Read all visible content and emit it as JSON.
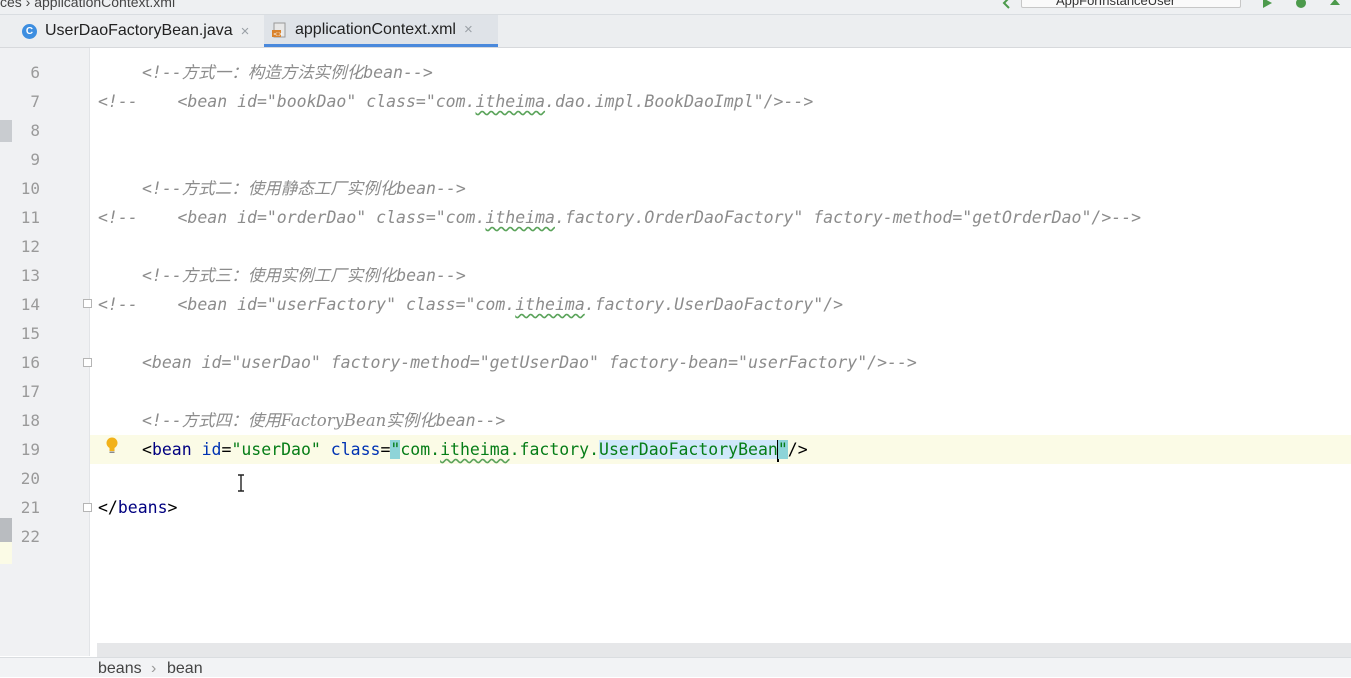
{
  "window": {
    "breadcrumb_top": "ces › applicationContext.xml",
    "run_config": "AppForInstanceUser"
  },
  "tabs": [
    {
      "label": "UserDaoFactoryBean.java",
      "icon": "java-class-icon",
      "active": false
    },
    {
      "label": "applicationContext.xml",
      "icon": "xml-file-icon",
      "active": true
    }
  ],
  "line_numbers": [
    "6",
    "7",
    "8",
    "9",
    "10",
    "11",
    "12",
    "13",
    "14",
    "15",
    "16",
    "17",
    "18",
    "19",
    "20",
    "21",
    "22"
  ],
  "code": {
    "l6": {
      "open": "<!--",
      "cn": "方式一：构造方法实例化",
      "tail": "bean-->"
    },
    "l7": {
      "a": "<!--    <bean id=\"bookDao\" class=\"com.",
      "b": "itheima",
      "c": ".dao.impl.BookDaoImpl\"/>-->"
    },
    "l10": {
      "open": "<!--",
      "cn": "方式二：使用静态工厂实例化",
      "tail": "bean-->"
    },
    "l11": {
      "a": "<!--    <bean id=\"orderDao\" class=\"com.",
      "b": "itheima",
      "c": ".factory.OrderDaoFactory\" factory-method=\"getOrderDao\"/>-->"
    },
    "l13": {
      "open": "<!--",
      "cn": "方式三：使用实例工厂实例化",
      "tail": "bean-->"
    },
    "l14": {
      "a": "<!--    <bean id=\"userFactory\" class=\"com.",
      "b": "itheima",
      "c": ".factory.UserDaoFactory\"/>"
    },
    "l16": {
      "text": "<bean id=\"userDao\" factory-method=\"getUserDao\" factory-bean=\"userFactory\"/>-->"
    },
    "l18": {
      "open": "<!--",
      "cn": "方式四：使用",
      "mid": "FactoryBean",
      "cn2": "实例化",
      "tail": "bean-->"
    },
    "l19": {
      "lt": "<",
      "tag": "bean",
      "attr1": "id",
      "eq1": "=",
      "val1": "\"userDao\"",
      "attr2": "class",
      "eq2": "=",
      "q1": "\"",
      "pkg": "com.",
      "pkg2": "itheima",
      "pkg3": ".factory.",
      "cls": "UserDaoFactoryBean",
      "q2": "\"",
      "end": "/>"
    },
    "l21": {
      "lt": "</",
      "tag": "beans",
      "gt": ">"
    }
  },
  "status_breadcrumb": [
    "beans",
    "bean"
  ]
}
